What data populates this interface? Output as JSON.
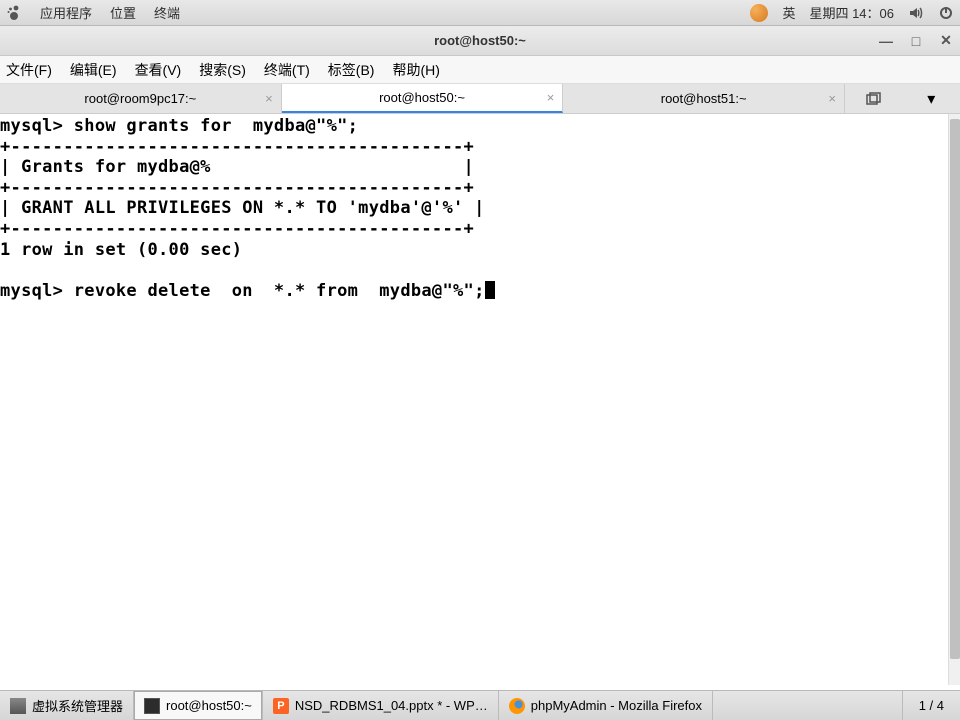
{
  "top_panel": {
    "apps": "应用程序",
    "places": "位置",
    "terminal": "终端",
    "ime": "英",
    "date": "星期四 14：06"
  },
  "window": {
    "title": "root@host50:~"
  },
  "menu": {
    "file": "文件(F)",
    "edit": "编辑(E)",
    "view": "查看(V)",
    "search": "搜索(S)",
    "terminal": "终端(T)",
    "tabs": "标签(B)",
    "help": "帮助(H)"
  },
  "tabs": {
    "tab1": "root@room9pc17:~",
    "tab2": "root@host50:~",
    "tab3": "root@host51:~"
  },
  "terminal_lines": [
    "mysql> show grants for  mydba@\"%\";",
    "+-------------------------------------------+",
    "| Grants for mydba@%                        |",
    "+-------------------------------------------+",
    "| GRANT ALL PRIVILEGES ON *.* TO 'mydba'@'%' |",
    "+-------------------------------------------+",
    "1 row in set (0.00 sec)",
    "",
    "mysql> revoke delete  on  *.* from  mydba@\"%\";"
  ],
  "bottom": {
    "vm": "虚拟系统管理器",
    "term": "root@host50:~",
    "wps": "NSD_RDBMS1_04.pptx * - WP…",
    "wps_icon": "P",
    "ff": "phpMyAdmin - Mozilla Firefox",
    "ws": "1 / 4"
  }
}
